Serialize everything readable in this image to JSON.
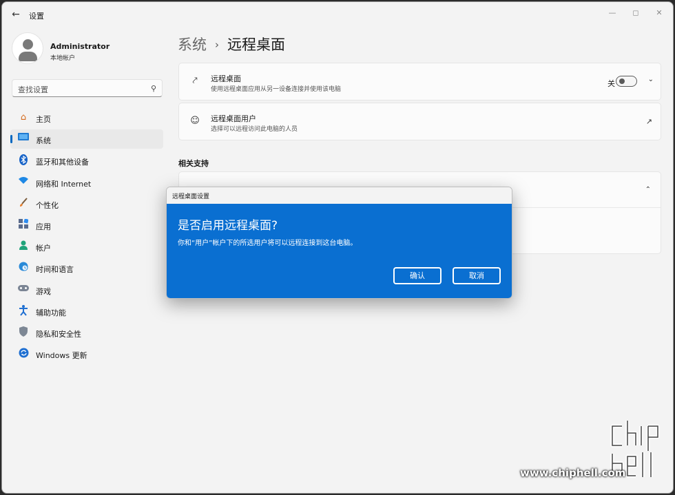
{
  "app": {
    "title": "设置",
    "back_icon": "back-arrow-icon",
    "controls": [
      "minimize",
      "maximize",
      "close"
    ]
  },
  "profile": {
    "name": "Administrator",
    "account_type": "本地帐户"
  },
  "search": {
    "placeholder": "查找设置"
  },
  "nav": {
    "items": [
      {
        "label": "主页",
        "icon": "home-icon",
        "active": false
      },
      {
        "label": "系统",
        "icon": "system-icon",
        "active": true
      },
      {
        "label": "蓝牙和其他设备",
        "icon": "bluetooth-icon",
        "active": false
      },
      {
        "label": "网络和 Internet",
        "icon": "wifi-icon",
        "active": false
      },
      {
        "label": "个性化",
        "icon": "brush-icon",
        "active": false
      },
      {
        "label": "应用",
        "icon": "apps-icon",
        "active": false
      },
      {
        "label": "帐户",
        "icon": "account-icon",
        "active": false
      },
      {
        "label": "时间和语言",
        "icon": "globe-icon",
        "active": false
      },
      {
        "label": "游戏",
        "icon": "gamepad-icon",
        "active": false
      },
      {
        "label": "辅助功能",
        "icon": "accessibility-icon",
        "active": false
      },
      {
        "label": "隐私和安全性",
        "icon": "shield-icon",
        "active": false
      },
      {
        "label": "Windows 更新",
        "icon": "update-icon",
        "active": false
      }
    ]
  },
  "breadcrumb": {
    "parent": "系统",
    "current": "远程桌面"
  },
  "remote_desktop_card": {
    "title": "远程桌面",
    "subtitle": "使用远程桌面应用从另一设备连接并使用该电脑",
    "toggle_state_label": "关",
    "toggle_on": false
  },
  "users_card": {
    "title": "远程桌面用户",
    "subtitle": "选择可以远程访问此电脑的人员"
  },
  "related": {
    "section_title": "相关支持"
  },
  "dialog": {
    "window_title": "远程桌面设置",
    "heading": "是否启用远程桌面?",
    "message": "你和“用户”帐户下的所选用户将可以远程连接到这台电脑。",
    "confirm_label": "确认",
    "cancel_label": "取消"
  },
  "watermark": {
    "text": "www.chiphell.com"
  },
  "colors": {
    "accent": "#0067c0",
    "dialog_bg": "#0a6fd1",
    "window_bg": "#f3f3f3"
  }
}
